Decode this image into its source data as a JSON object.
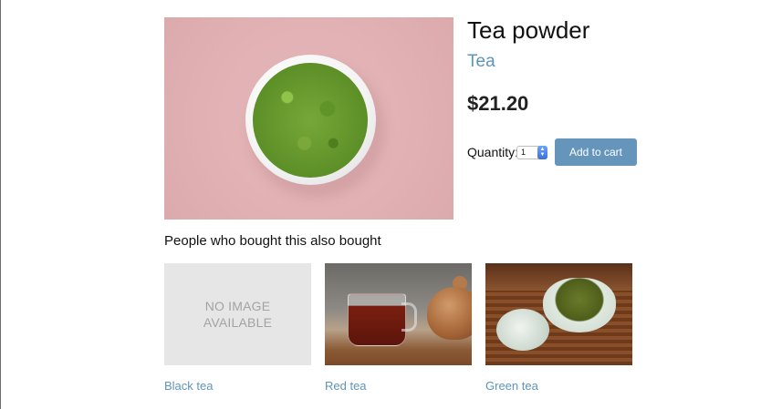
{
  "product": {
    "title": "Tea powder",
    "category": "Tea",
    "price": "$21.20",
    "quantity_label": "Quantity:",
    "quantity_value": "1",
    "add_to_cart_label": "Add to cart"
  },
  "also_bought": {
    "heading": "People who bought this also bought",
    "items": [
      {
        "name": "Black tea",
        "image_text": "NO IMAGE\nAVAILABLE"
      },
      {
        "name": "Red tea"
      },
      {
        "name": "Green tea"
      }
    ]
  },
  "colors": {
    "link": "#5e94bb",
    "button": "#6695bc",
    "hero_background": "#e1b1b4"
  }
}
